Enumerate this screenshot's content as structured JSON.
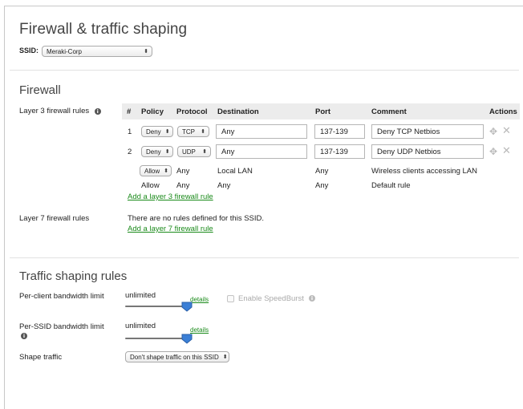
{
  "page": {
    "title": "Firewall & traffic shaping",
    "ssid_label": "SSID:",
    "ssid_value": "Meraki-Corp"
  },
  "firewall": {
    "heading": "Firewall",
    "l3_label": "Layer 3 firewall rules",
    "columns": [
      "#",
      "Policy",
      "Protocol",
      "Destination",
      "Port",
      "Comment",
      "Actions"
    ],
    "rules": [
      {
        "num": "1",
        "policy": "Deny",
        "protocol": "TCP",
        "destination": "Any",
        "port": "137-139",
        "comment": "Deny TCP Netbios"
      },
      {
        "num": "2",
        "policy": "Deny",
        "protocol": "UDP",
        "destination": "Any",
        "port": "137-139",
        "comment": "Deny UDP Netbios"
      }
    ],
    "lan_rule": {
      "policy": "Allow",
      "protocol": "Any",
      "destination": "Local LAN",
      "port": "Any",
      "comment": "Wireless clients accessing LAN"
    },
    "default_rule": {
      "policy": "Allow",
      "protocol": "Any",
      "destination": "Any",
      "port": "Any",
      "comment": "Default rule"
    },
    "add_l3_link": "Add a layer 3 firewall rule",
    "l7_label": "Layer 7 firewall rules",
    "l7_empty": "There are no rules defined for this SSID.",
    "add_l7_link": "Add a layer 7 firewall rule"
  },
  "shaping": {
    "heading": "Traffic shaping rules",
    "per_client_label": "Per-client bandwidth limit",
    "per_client_value": "unlimited",
    "per_client_details": "details",
    "per_client_slider_level": 1.0,
    "speedburst_label": "Enable SpeedBurst",
    "speedburst_checked": false,
    "per_ssid_label": "Per-SSID bandwidth limit",
    "per_ssid_value": "unlimited",
    "per_ssid_details": "details",
    "per_ssid_slider_level": 1.0,
    "shape_label": "Shape traffic",
    "shape_value": "Don't shape traffic on this SSID"
  },
  "icons": {
    "info": "info-icon",
    "move": "move-icon",
    "delete": "close-icon",
    "select_arrows": "updown-arrows-icon"
  },
  "colors": {
    "link": "#1a8a1a",
    "slider_thumb": "#3b7fd6",
    "header_bg": "#ececec"
  }
}
